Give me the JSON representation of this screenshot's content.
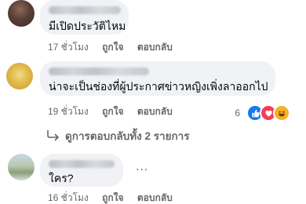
{
  "comments": [
    {
      "text": "มีเปิดประวัติไหม",
      "time": "17 ชั่วโมง",
      "like_label": "ถูกใจ",
      "reply_label": "ตอบกลับ"
    },
    {
      "text": "น่าจะเป็นช่องที่ผู้ประกาศข่าวหญิงเพิ่งลาออกไป",
      "time": "19 ชั่วโมง",
      "like_label": "ถูกใจ",
      "reply_label": "ตอบกลับ",
      "reaction_count": "6"
    },
    {
      "text": "ใคร?",
      "time": "16 ชั่วโมง",
      "like_label": "ถูกใจ",
      "reply_label": "ตอบกลับ"
    }
  ],
  "view_replies": "ดูการตอบกลับทั้ง 2 รายการ",
  "more_label": "...",
  "colors": {
    "bubble": "#f0f2f5",
    "meta_text": "#65676b",
    "like_blue": "#1877f2",
    "love_red": "#f33e58",
    "haha_yellow": "#f7b125"
  }
}
